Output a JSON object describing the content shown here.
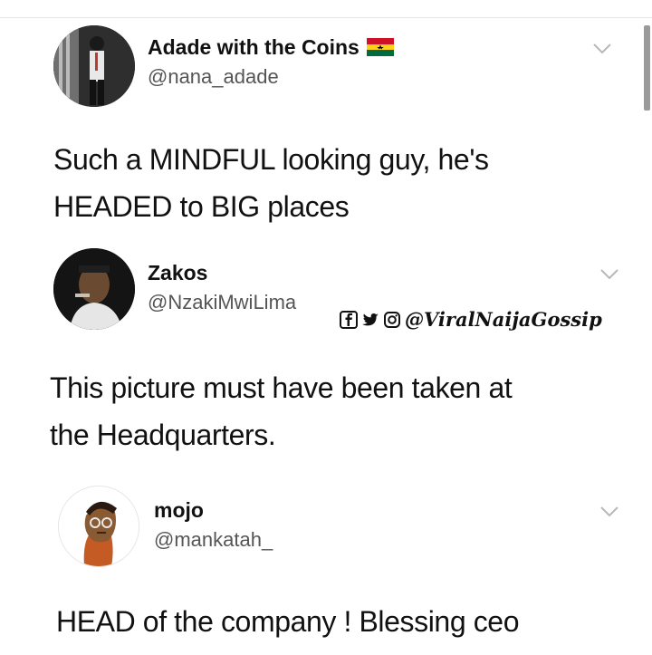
{
  "tweets": [
    {
      "name": "Adade with the Coins",
      "handle": "@nana_adade",
      "text_lines": [
        "Such a MINDFUL looking guy, he's",
        "HEADED to BIG places"
      ],
      "avatar_icon": "person-photo"
    },
    {
      "name": "Zakos",
      "handle": "@NzakiMwiLima",
      "text_lines": [
        "This picture must have been taken at",
        "the Headquarters."
      ],
      "avatar_icon": "person-photo"
    },
    {
      "name": "mojo",
      "handle": "@mankatah_",
      "text_lines": [
        "HEAD of the company ! Blessing ceo"
      ],
      "avatar_icon": "cartoon-avatar"
    }
  ],
  "watermark": {
    "handle": "@ViralNaijaGossip",
    "icons": [
      "facebook-icon",
      "twitter-icon",
      "instagram-icon"
    ]
  },
  "colors": {
    "name": "#111111",
    "handle": "#555555",
    "chevron": "#b8b8b8",
    "divider": "#e6e6e6"
  }
}
